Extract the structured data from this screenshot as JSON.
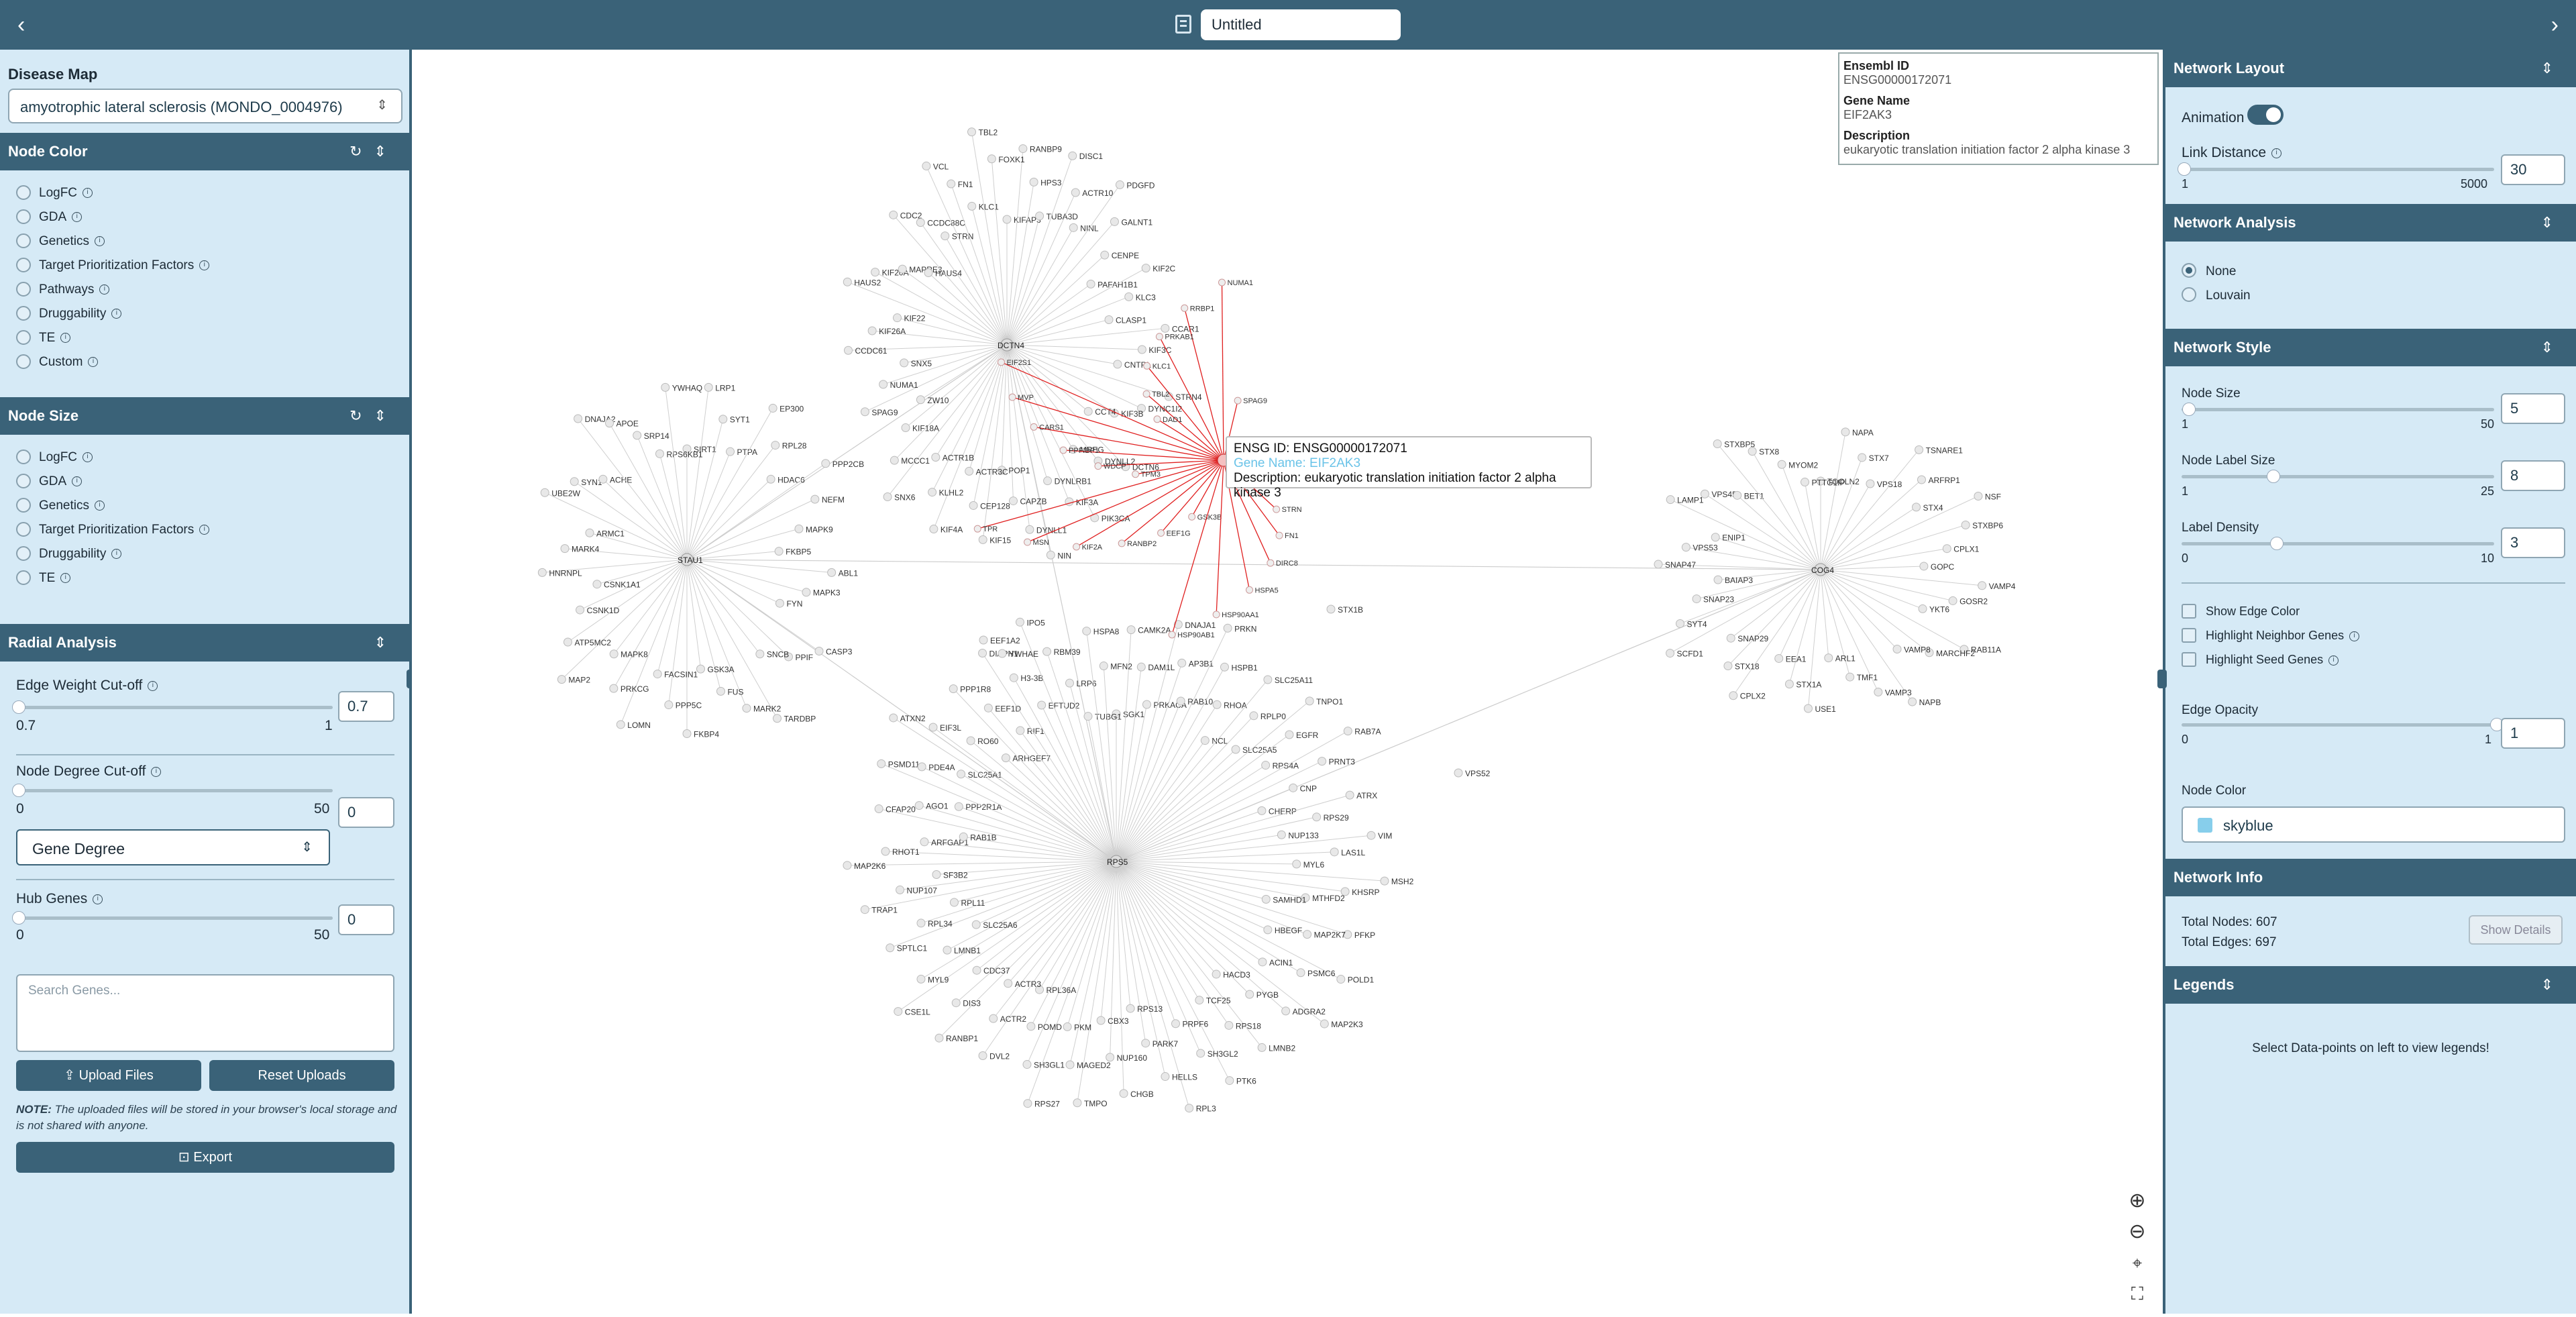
{
  "topbar": {
    "title": "Untitled"
  },
  "left": {
    "disease_map": {
      "label": "Disease Map",
      "selected": "amyotrophic lateral sclerosis (MONDO_0004976)"
    },
    "node_color": {
      "title": "Node Color",
      "options": [
        "LogFC",
        "GDA",
        "Genetics",
        "Target Prioritization Factors",
        "Pathways",
        "Druggability",
        "TE",
        "Custom"
      ]
    },
    "node_size": {
      "title": "Node Size",
      "options": [
        "LogFC",
        "GDA",
        "Genetics",
        "Target Prioritization Factors",
        "Druggability",
        "TE"
      ]
    },
    "radial": {
      "title": "Radial Analysis",
      "edge_weight": {
        "label": "Edge Weight Cut-off",
        "min": "0.7",
        "max": "1",
        "value": "0.7"
      },
      "node_degree": {
        "label": "Node Degree Cut-off",
        "min": "0",
        "max": "50",
        "value": "0"
      },
      "degree_select": "Gene Degree",
      "hub_genes": {
        "label": "Hub Genes",
        "min": "0",
        "max": "50",
        "value": "0"
      }
    },
    "search_placeholder": "Search Genes...",
    "upload_label": "Upload Files",
    "reset_label": "Reset Uploads",
    "note_label": "NOTE:",
    "note_text": "The uploaded files will be stored in your browser's local storage and is not shared with anyone.",
    "export_label": "Export"
  },
  "tooltip_panel": {
    "ensembl_label": "Ensembl ID",
    "ensembl_value": "ENSG00000172071",
    "gene_label": "Gene Name",
    "gene_value": "EIF2AK3",
    "desc_label": "Description",
    "desc_value": "eukaryotic translation initiation factor 2 alpha kinase 3"
  },
  "hover_tooltip": {
    "line1": "ENSG ID: ENSG00000172071",
    "line2": "Gene Name: EIF2AK3",
    "line3": "Description: eukaryotic translation initiation factor 2 alpha kinase 3"
  },
  "right": {
    "layout": {
      "title": "Network Layout",
      "animation_label": "Animation",
      "link_label": "Link Distance",
      "link_min": "1",
      "link_max": "5000",
      "link_value": "30"
    },
    "analysis": {
      "title": "Network Analysis",
      "options": [
        "None",
        "Louvain"
      ]
    },
    "style": {
      "title": "Network Style",
      "node_size": {
        "label": "Node Size",
        "min": "1",
        "max": "50",
        "value": "5"
      },
      "node_label_size": {
        "label": "Node Label Size",
        "min": "1",
        "max": "25",
        "value": "8"
      },
      "label_density": {
        "label": "Label Density",
        "min": "0",
        "max": "10",
        "value": "3"
      },
      "checks": [
        "Show Edge Color",
        "Highlight Neighbor Genes",
        "Highlight Seed Genes"
      ],
      "edge_opacity": {
        "label": "Edge Opacity",
        "min": "0",
        "max": "1",
        "value": "1"
      },
      "node_color_label": "Node Color",
      "node_color_value": "skyblue"
    },
    "info": {
      "title": "Network Info",
      "nodes": "Total Nodes: 607",
      "edges": "Total Edges: 697",
      "details": "Show Details"
    },
    "legends": {
      "title": "Legends",
      "message": "Select Data-points on left to view legends!"
    }
  },
  "colors": {
    "header": "#3a6278",
    "panel": "#d6eaf6",
    "edge": "#c8c8c8",
    "highlight_edge": "#e02020",
    "node": "#dcdcdc"
  },
  "network": {
    "hubs": [
      {
        "name": "DCTN4",
        "genes": [
          "KIFAP3",
          "RANBP9",
          "HPS3",
          "TUBA3D",
          "DISC1",
          "ACTR10",
          "NINL",
          "PDGFD",
          "GALNT1",
          "CENPE",
          "PAFAH1B1",
          "KIF2C",
          "KLC3",
          "CLASP1",
          "CCAR1",
          "KIF3C",
          "CNTRL",
          "STRN4",
          "DYNC1I2",
          "KIF3B",
          "CCT4",
          "DCTN6",
          "DYNLL2",
          "MREG",
          "PIK3CA",
          "KIF3A",
          "DYNLRB1",
          "NIN",
          "DYNLL1",
          "CAPZB",
          "POP1",
          "KIF15",
          "CEP128",
          "ACTR3C",
          "KIF4A",
          "KLHL2",
          "ACTR1B",
          "SNX6",
          "MCCC1",
          "KIF18A",
          "ZW10",
          "SPAG9",
          "NUMA1",
          "SNX5",
          "CCDC61",
          "KIF26A",
          "KIF22",
          "HAUS2",
          "KIF20A",
          "MAPRE3",
          "HAUS4",
          "CDC2",
          "CCDC88C",
          "STRN",
          "VCL",
          "FN1",
          "KLC1",
          "TBL2",
          "FOXK1"
        ]
      },
      {
        "name": "STAU1",
        "genes": [
          "SIRT1",
          "LRP1",
          "SYT1",
          "PTPA",
          "EP300",
          "RPL28",
          "HDAC6",
          "PPP2CB",
          "NEFM",
          "MAPK9",
          "FKBP5",
          "ABL1",
          "MAPK3",
          "FYN",
          "CASP3",
          "PPIF",
          "SNCB",
          "TARDBP",
          "MARK2",
          "FUS",
          "GSK3A",
          "FKBP4",
          "PPP5C",
          "FACSIN1",
          "LOMN",
          "PRKCG",
          "MAPK8",
          "MAP2",
          "ATP5MC2",
          "CSNK1D",
          "CSNK1A1",
          "HNRNPL",
          "MARK4",
          "ARMC1",
          "UBE2W",
          "SYN1",
          "ACHE",
          "DNAJA2",
          "APOE",
          "SRP14",
          "RPS6KB1",
          "YWHAQ"
        ]
      },
      {
        "name": "RPS5",
        "genes": [
          "SGK1",
          "CAMK2A",
          "DAM1L",
          "PRKACA",
          "DNAJA1",
          "AP3B1",
          "RAB10",
          "PRKN",
          "HSPB1",
          "RHOA",
          "NCL",
          "SLC25A11",
          "RPLP0",
          "SLC25A5",
          "TNPO1",
          "EGFR",
          "RPS4A",
          "RAB7A",
          "PRNT3",
          "CNP",
          "CHERP",
          "ATRX",
          "RPS29",
          "NUP133",
          "VIM",
          "LAS1L",
          "MYL6",
          "MSH2",
          "KHSRP",
          "MTHFD2",
          "SAMHD1",
          "PFKP",
          "MAP2K7",
          "HBEGF",
          "POLD1",
          "PSMC6",
          "ACIN1",
          "MAP2K3",
          "ADGRA2",
          "PYGB",
          "HACD3",
          "LMNB2",
          "RPS18",
          "TCF25",
          "PTK6",
          "SH3GL2",
          "PRPF6",
          "RPL3",
          "HELLS",
          "PARK7",
          "RPS13",
          "CHGB",
          "NUP160",
          "CBX3",
          "TMPO",
          "MAGED2",
          "PKM",
          "RPS27",
          "SH3GL1",
          "POMD",
          "RPL36A",
          "DVL2",
          "ACTR2",
          "ACTR3",
          "RANBP1",
          "DIS3",
          "CDC37",
          "CSE1L",
          "MYL9",
          "LMNB1",
          "SLC25A6",
          "SPTLC1",
          "RPL34",
          "RPL11",
          "TRAP1",
          "NUP107",
          "SF3B2",
          "MAP2K6",
          "RHOT1",
          "ARFGAP1",
          "RAB1B",
          "CFAP20",
          "AGO1",
          "PPP2R1A",
          "PSMD11",
          "PDE4A",
          "SLC25A1",
          "ATXN2",
          "EIF3L",
          "RO60",
          "ARHGEF7",
          "PPP1R8",
          "EEF1D",
          "RIF1",
          "DIAPH1",
          "H3-3B",
          "EFTUD2",
          "IPO5",
          "RBM39",
          "LRP6",
          "TUBG1",
          "HSPA8",
          "MFN2"
        ]
      },
      {
        "name": "COG4",
        "genes": [
          "TOOLN2",
          "NAPA",
          "STX7",
          "VPS18",
          "TSNARE1",
          "ARFRP1",
          "STX4",
          "NSF",
          "STXBP6",
          "CPLX1",
          "GOPC",
          "VAMP4",
          "GOSR2",
          "YKT6",
          "RAB11A",
          "MARCHF2",
          "VAMP8",
          "NAPB",
          "VAMP3",
          "TMF1",
          "ARL1",
          "USE1",
          "STX1A",
          "EEA1",
          "CPLX2",
          "STX18",
          "SNAP29",
          "SCFD1",
          "SYT4",
          "SNAP23",
          "BAIAP3",
          "SNAP47",
          "VPS53",
          "ENIP1",
          "LAMP1",
          "VPS45",
          "BET1",
          "STXBP5",
          "STX8",
          "MYOM2",
          "PTTG1IP"
        ]
      }
    ],
    "highlight": {
      "name": "EIF2AK3",
      "genes": [
        "SPAG9",
        "NUMA1",
        "RRBP1",
        "PRKAB1",
        "KLC1",
        "TBL2",
        "DAD1",
        "EIF2S1",
        "MVP",
        "CARS1",
        "PPFIBP1",
        "WDCP",
        "TPM3",
        "TPR",
        "MSN",
        "KIF2A",
        "RANBP2",
        "EEF1G",
        "GSK3B",
        "HSP90AB1",
        "HSP90AA1",
        "HSPA5",
        "DIRC8",
        "FN1",
        "STRN"
      ]
    },
    "bridges": [
      "STX1B",
      "VPS52",
      "EEF1A2",
      "YWHAE"
    ]
  }
}
